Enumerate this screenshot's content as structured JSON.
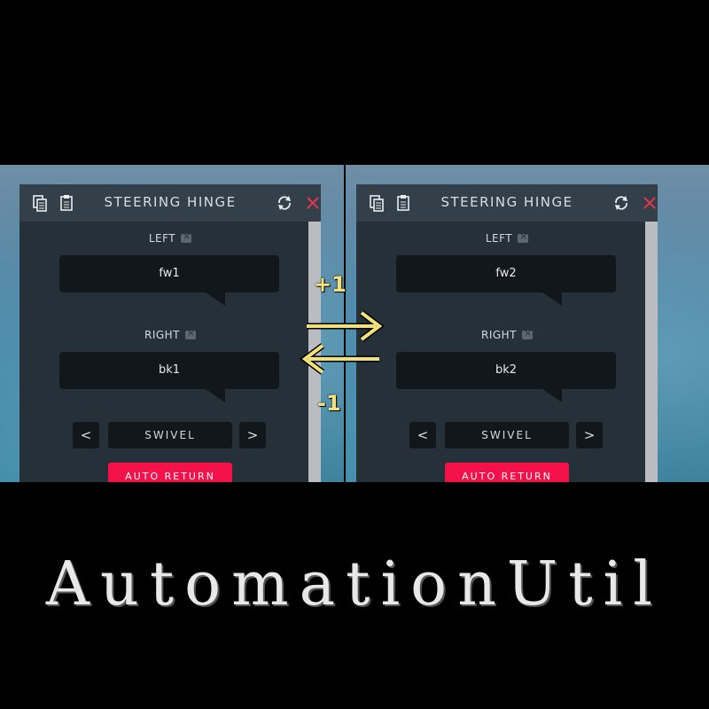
{
  "left_panel": {
    "title": "STEERING HINGE",
    "left_label": "LEFT",
    "left_value": "fw1",
    "right_label": "RIGHT",
    "right_value": "bk1",
    "mode": "SWIVEL",
    "prev": "<",
    "next": ">",
    "auto_return": "AUTO RETURN"
  },
  "right_panel": {
    "title": "STEERING HINGE",
    "left_label": "LEFT",
    "left_value": "fw2",
    "right_label": "RIGHT",
    "right_value": "bk2",
    "mode": "SWIVEL",
    "prev": "<",
    "next": ">",
    "auto_return": "AUTO RETURN"
  },
  "annotations": {
    "plus": "+1",
    "minus": "-1"
  },
  "brand": "AutomationUtil",
  "colors": {
    "accent": "#f5124a",
    "close": "#e2344c",
    "arrow": "#f1e17a"
  }
}
